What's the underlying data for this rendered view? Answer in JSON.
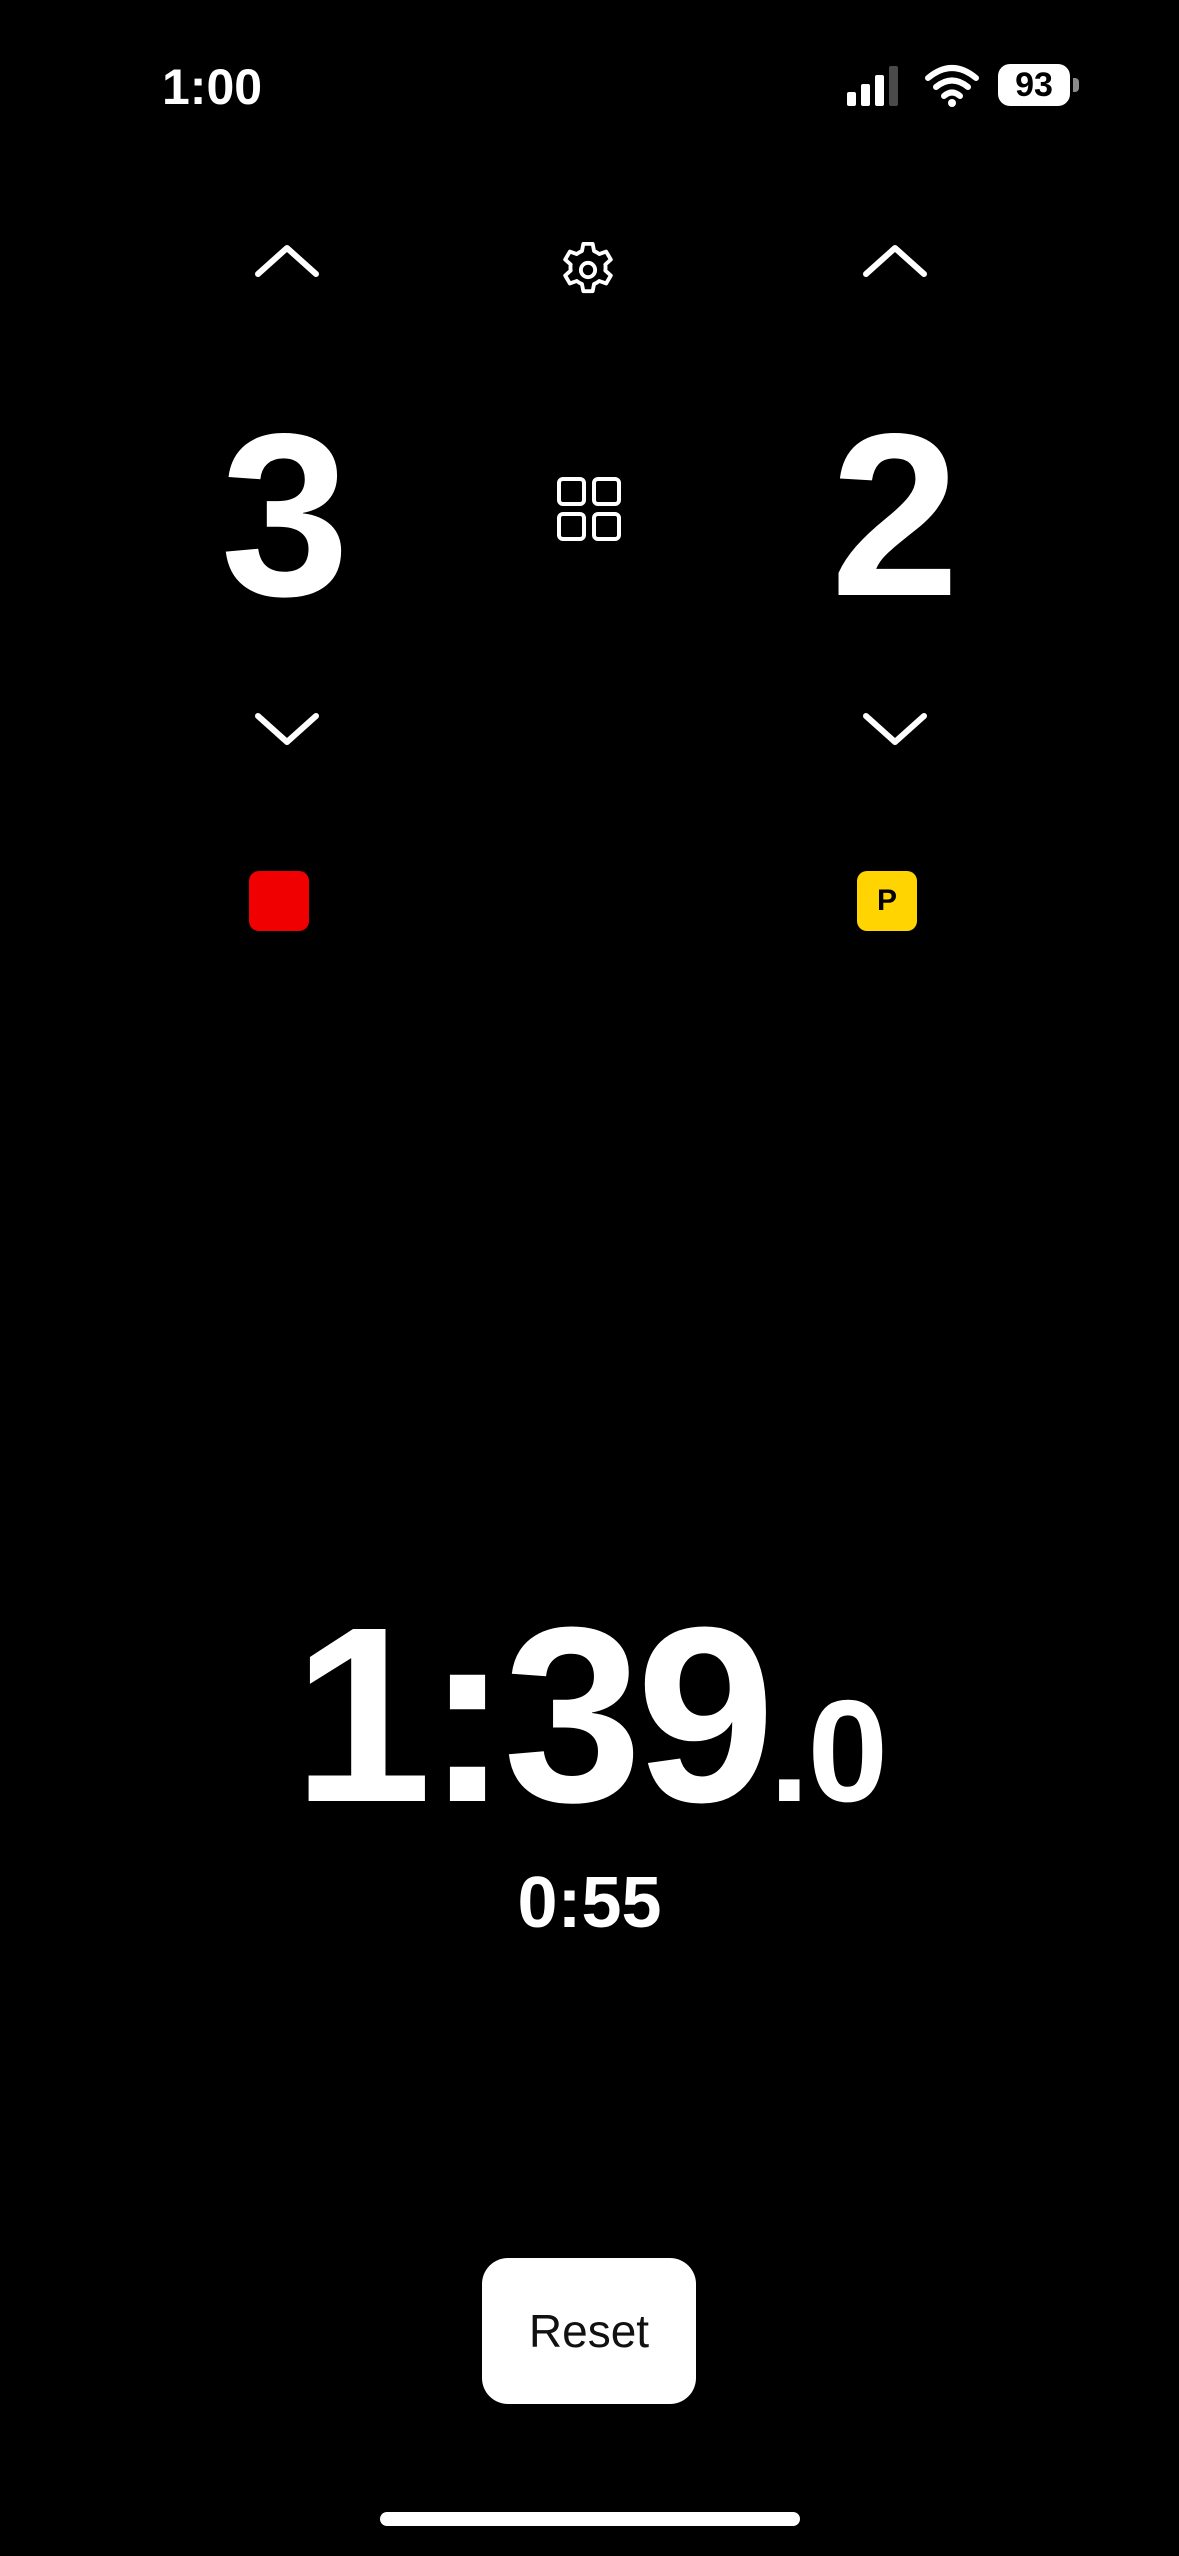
{
  "status_bar": {
    "time": "1:00",
    "battery": "93",
    "icons": [
      "signal-icon",
      "wifi-icon",
      "battery-icon"
    ]
  },
  "scoreboard": {
    "left_score": "3",
    "right_score": "2",
    "left_card_color": "#f00000",
    "right_card_color": "#ffd400",
    "right_card_label": "P",
    "icons": [
      "chevron-up-icon",
      "chevron-down-icon",
      "gear-icon",
      "grid-icon"
    ]
  },
  "timer": {
    "main": "1:39",
    "decimal": ".0",
    "sub": "0:55"
  },
  "actions": {
    "reset_label": "Reset"
  }
}
